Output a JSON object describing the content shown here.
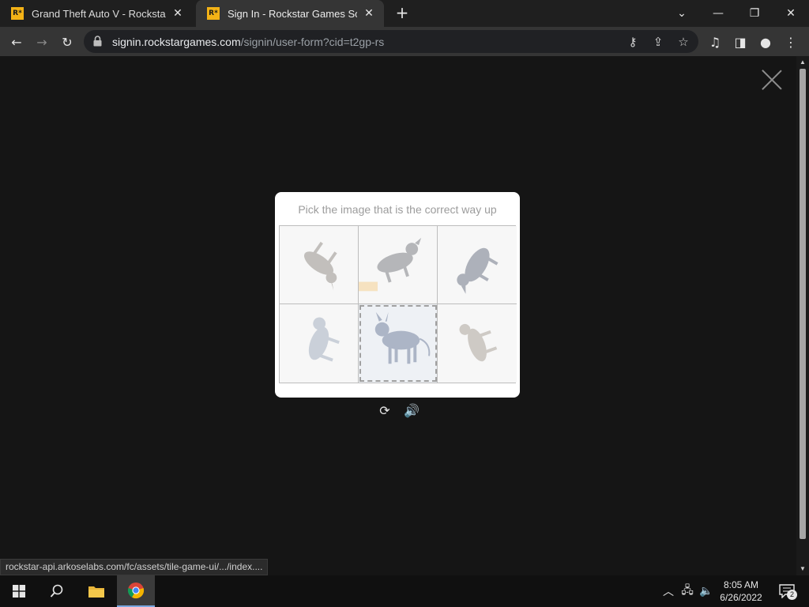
{
  "browser": {
    "tabs": [
      {
        "title": "Grand Theft Auto V - Rockstar Ga",
        "favicon": "R*",
        "active": false
      },
      {
        "title": "Sign In - Rockstar Games Social C",
        "favicon": "R*",
        "active": true
      }
    ],
    "new_tab_label": "+",
    "url_host": "signin.rockstargames.com",
    "url_path": "/signin/user-form?cid=t2gp-rs"
  },
  "captcha": {
    "prompt": "Pick the image that is the correct way up",
    "tiles": [
      {
        "icon": "upside-down-animal-tile-1",
        "selected": false
      },
      {
        "icon": "upside-down-animal-tile-2",
        "selected": false
      },
      {
        "icon": "upside-down-animal-tile-3",
        "selected": false
      },
      {
        "icon": "upside-down-animal-tile-4",
        "selected": false
      },
      {
        "icon": "upright-animal-tile-5",
        "selected": true
      },
      {
        "icon": "upside-down-animal-tile-6",
        "selected": false
      }
    ],
    "refresh_icon": "refresh-icon",
    "audio_icon": "speaker-icon"
  },
  "status_bar": {
    "text": "rockstar-api.arkoselabs.com/fc/assets/tile-game-ui/.../index...."
  },
  "taskbar": {
    "time": "8:05 AM",
    "date": "6/26/2022",
    "notification_count": "2"
  },
  "colors": {
    "page_bg": "#151515",
    "card_bg": "#ffffff",
    "favicon": "#f3b216",
    "active_tab": "#353535"
  }
}
